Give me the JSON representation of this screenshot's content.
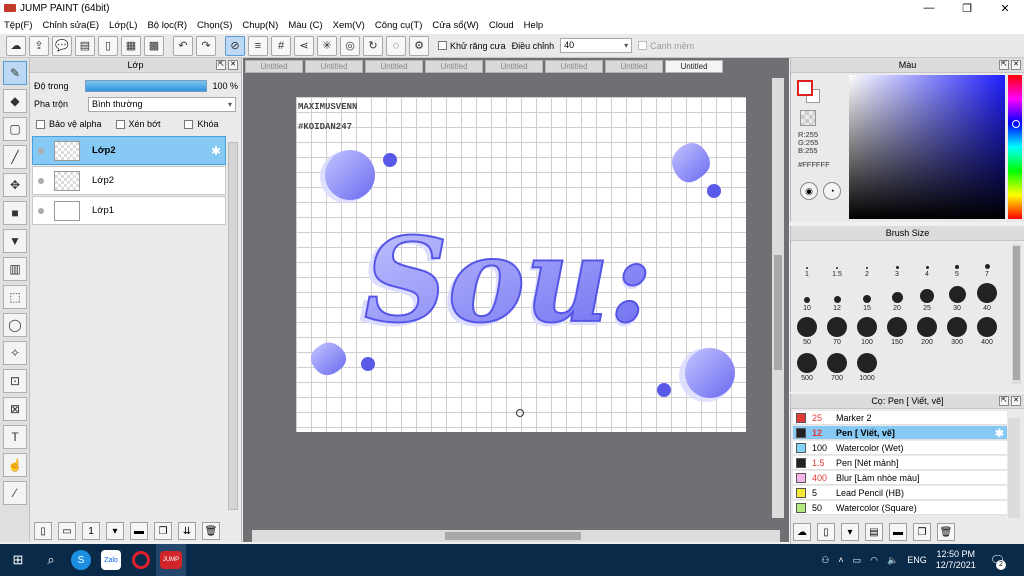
{
  "window": {
    "title": "JUMP PAINT (64bit)",
    "min": "—",
    "max": "❐",
    "close": "✕"
  },
  "menu": [
    "Tệp(F)",
    "Chỉnh sửa(E)",
    "Lớp(L)",
    "Bộ lọc(R)",
    "Chọn(S)",
    "Chụp(N)",
    "Màu (C)",
    "Xem(V)",
    "Công cụ(T)",
    "Cửa sổ(W)",
    "Cloud",
    "Help"
  ],
  "toolbar": {
    "antialias_label": "Khử răng cưa",
    "adjust_label": "Điều chỉnh",
    "adjust_value": "40",
    "snap_label": "Canh mềm"
  },
  "layer_panel": {
    "title": "Lớp",
    "opacity_label": "Độ trong",
    "opacity_value": "100 %",
    "opacity_fraction": 1.0,
    "blend_label": "Pha trộn",
    "blend_value": "Bình thường",
    "protect_alpha": "Bảo vệ alpha",
    "clip": "Xén bớt",
    "lock": "Khóa",
    "layers": [
      {
        "name": "Lớp2",
        "active": true
      },
      {
        "name": "Lớp2",
        "active": false
      },
      {
        "name": "Lớp1",
        "active": false
      }
    ]
  },
  "tabs": [
    "Untitled",
    "Untitled",
    "Untitled",
    "Untitled",
    "Untitled",
    "Untitled",
    "Untitled",
    "Untitled"
  ],
  "active_tab_index": 7,
  "artwork": {
    "text": "Sou:",
    "credit_1": "MAXIMUSVENN",
    "credit_2": "#KOIDAN247",
    "accent": "#6a6af0"
  },
  "color_panel": {
    "title": "Màu",
    "r": "R:255",
    "g": "G:255",
    "b": "B:255",
    "hex": "#FFFFFF",
    "fg_color": "#ffffff"
  },
  "brush_panel": {
    "title": "Brush Size",
    "sizes": [
      "1",
      "1.5",
      "2",
      "3",
      "4",
      "5",
      "7",
      "10",
      "12",
      "15",
      "20",
      "25",
      "30",
      "40",
      "50",
      "70",
      "100",
      "150",
      "200",
      "300",
      "400",
      "500",
      "700",
      "1000"
    ]
  },
  "tool_panel": {
    "title": "Cọ: Pen [ Viết, vẽ]",
    "items": [
      {
        "size": "25",
        "name": "Marker 2",
        "color": "#e53935",
        "active": false,
        "size_color": "#e53935"
      },
      {
        "size": "12",
        "name": "Pen [ Viết, vẽ]",
        "color": "#222222",
        "active": true,
        "size_color": "#e53935"
      },
      {
        "size": "100",
        "name": "Watercolor (Wet)",
        "color": "#7fd7f5",
        "active": false,
        "size_color": "#000000"
      },
      {
        "size": "1.5",
        "name": "Pen [Nét mảnh]",
        "color": "#222222",
        "active": false,
        "size_color": "#e53935"
      },
      {
        "size": "400",
        "name": "Blur [Làm nhòe màu]",
        "color": "#f5b5e8",
        "active": false,
        "size_color": "#e53935"
      },
      {
        "size": "5",
        "name": "Lead Pencil (HB)",
        "color": "#f5e63a",
        "active": false,
        "size_color": "#000000"
      },
      {
        "size": "50",
        "name": "Watercolor (Square)",
        "color": "#b5e87f",
        "active": false,
        "size_color": "#000000"
      }
    ]
  },
  "taskbar": {
    "lang": "ENG",
    "time": "12:50 PM",
    "date": "12/7/2021",
    "notif": "2"
  }
}
